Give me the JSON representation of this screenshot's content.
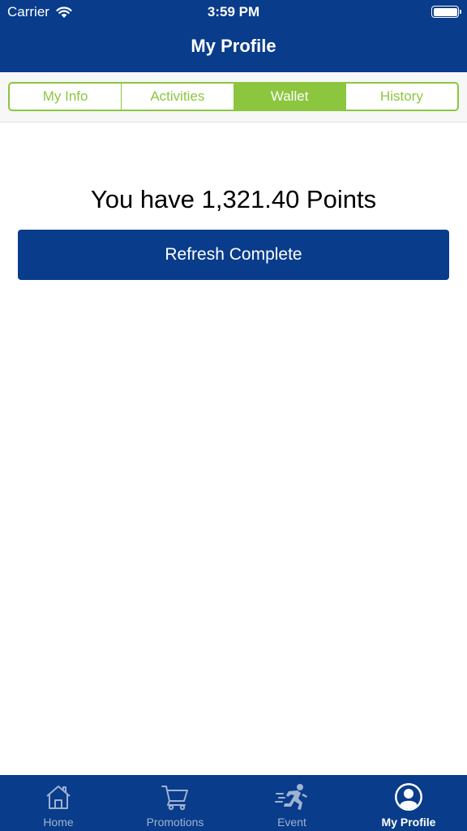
{
  "status_bar": {
    "carrier": "Carrier",
    "time": "3:59 PM"
  },
  "header": {
    "title": "My Profile"
  },
  "segments": [
    {
      "label": "My Info",
      "active": false
    },
    {
      "label": "Activities",
      "active": false
    },
    {
      "label": "Wallet",
      "active": true
    },
    {
      "label": "History",
      "active": false
    }
  ],
  "wallet": {
    "points_text": "You have 1,321.40 Points",
    "refresh_label": "Refresh Complete"
  },
  "tab_bar": [
    {
      "label": "Home",
      "icon": "home-icon",
      "active": false
    },
    {
      "label": "Promotions",
      "icon": "cart-icon",
      "active": false
    },
    {
      "label": "Event",
      "icon": "runner-icon",
      "active": false
    },
    {
      "label": "My Profile",
      "icon": "profile-icon",
      "active": true
    }
  ],
  "colors": {
    "brand_blue": "#093c8a",
    "accent_green": "#8cc63f"
  }
}
